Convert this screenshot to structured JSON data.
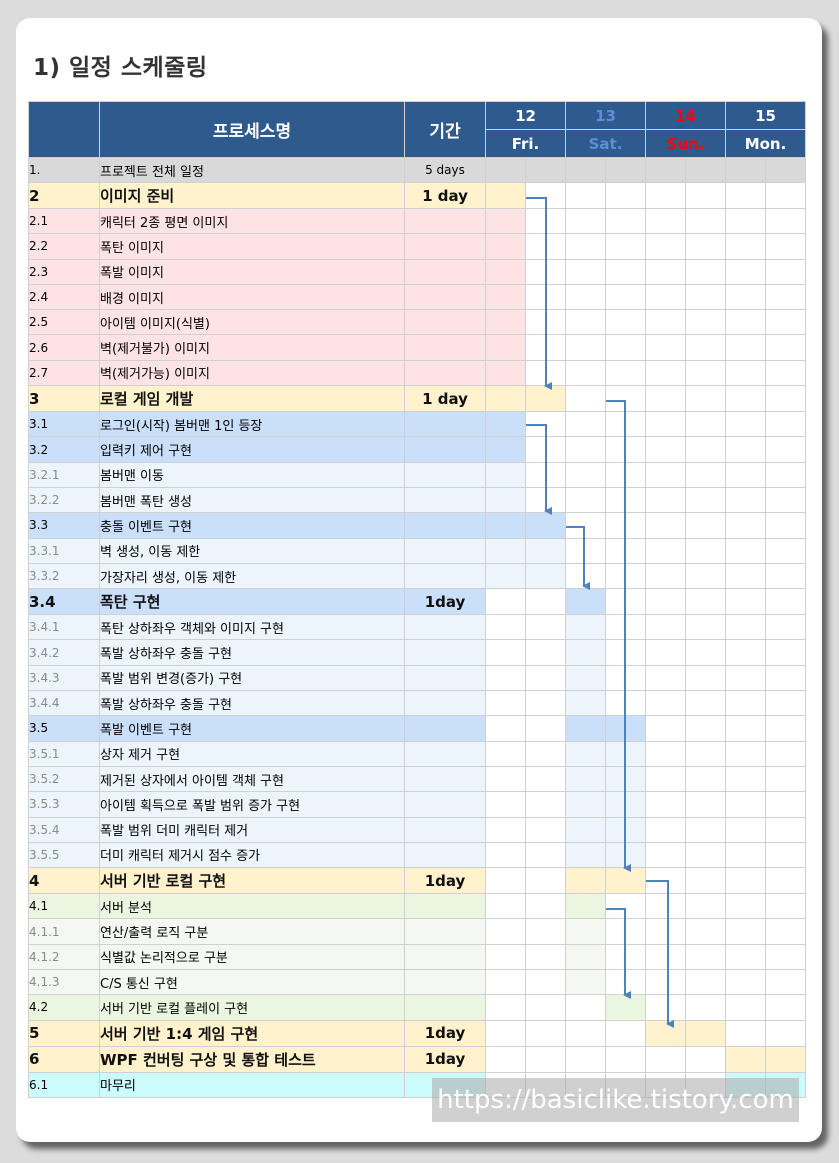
{
  "title": "1)  일정 스케줄링",
  "header": {
    "process": "프로세스명",
    "duration": "기간",
    "days": [
      {
        "day": "12",
        "dow": "Fri.",
        "color": "#ffffff"
      },
      {
        "day": "13",
        "dow": "Sat.",
        "color": "#5b8fd6"
      },
      {
        "day": "14",
        "dow": "Sun.",
        "color": "#ff0000"
      },
      {
        "day": "15",
        "dow": "Mon.",
        "color": "#ffffff"
      }
    ]
  },
  "rows": [
    {
      "num": "1.",
      "name": "프로젝트 전체 일정",
      "dur": "5 days",
      "level": "top",
      "bg": "#d9d9d9",
      "bars": [],
      "barColor": "#d9d9d9"
    },
    {
      "num": "2",
      "name": "이미지 준비",
      "dur": "1 day",
      "level": 1,
      "bg": "#fff2cc",
      "bars": [
        0
      ],
      "barColor": "#fff2cc"
    },
    {
      "num": "2.1",
      "name": "캐릭터 2종 평면 이미지",
      "dur": "",
      "level": 2,
      "bg": "#fde3e3",
      "bars": [
        0
      ],
      "barColor": "#fde3e3"
    },
    {
      "num": "2.2",
      "name": "폭탄 이미지",
      "dur": "",
      "level": 2,
      "bg": "#fde3e3",
      "bars": [
        0
      ],
      "barColor": "#fde3e3"
    },
    {
      "num": "2.3",
      "name": "폭발 이미지",
      "dur": "",
      "level": 2,
      "bg": "#fde3e3",
      "bars": [
        0
      ],
      "barColor": "#fde3e3"
    },
    {
      "num": "2.4",
      "name": "배경 이미지",
      "dur": "",
      "level": 2,
      "bg": "#fde3e3",
      "bars": [
        0
      ],
      "barColor": "#fde3e3"
    },
    {
      "num": "2.5",
      "name": "아이템 이미지(식별)",
      "dur": "",
      "level": 2,
      "bg": "#fde3e3",
      "bars": [
        0
      ],
      "barColor": "#fde3e3"
    },
    {
      "num": "2.6",
      "name": "벽(제거불가)  이미지",
      "dur": "",
      "level": 2,
      "bg": "#fde3e3",
      "bars": [
        0
      ],
      "barColor": "#fde3e3"
    },
    {
      "num": "2.7",
      "name": "벽(제거가능)  이미지",
      "dur": "",
      "level": 2,
      "bg": "#fde3e3",
      "bars": [
        0
      ],
      "barColor": "#fde3e3"
    },
    {
      "num": "3",
      "name": "로컬 게임 개발",
      "dur": "1 day",
      "level": 1,
      "bg": "#fff2cc",
      "bars": [
        0,
        1
      ],
      "barColor": "#fff2cc"
    },
    {
      "num": "3.1",
      "name": "로그인(시작) 봄버맨 1인 등장",
      "dur": "",
      "level": 2,
      "bg": "#c9dffa",
      "bars": [
        0
      ],
      "barColor": "#c9dffa"
    },
    {
      "num": "3.2",
      "name": "입력키 제어 구현",
      "dur": "",
      "level": 2,
      "bg": "#c9dffa",
      "bars": [
        0
      ],
      "barColor": "#c9dffa"
    },
    {
      "num": "3.2.1",
      "name": "봄버맨 이동",
      "dur": "",
      "level": 3,
      "bg": "#ecf4fc",
      "bars": [
        0
      ],
      "barColor": "#ecf4fc"
    },
    {
      "num": "3.2.2",
      "name": "봄버맨 폭탄 생성",
      "dur": "",
      "level": 3,
      "bg": "#ecf4fc",
      "bars": [
        0
      ],
      "barColor": "#ecf4fc"
    },
    {
      "num": "3.3",
      "name": "충돌 이벤트 구현",
      "dur": "",
      "level": 2,
      "bg": "#c9dffa",
      "bars": [
        0,
        1
      ],
      "barColor": "#c9dffa"
    },
    {
      "num": "3.3.1",
      "name": "벽 생성, 이동 제한",
      "dur": "",
      "level": 3,
      "bg": "#ecf4fc",
      "bars": [
        0,
        1
      ],
      "barColor": "#ecf4fc"
    },
    {
      "num": "3.3.2",
      "name": "가장자리 생성, 이동 제한",
      "dur": "",
      "level": 3,
      "bg": "#ecf4fc",
      "bars": [
        0,
        1
      ],
      "barColor": "#ecf4fc"
    },
    {
      "num": "3.4",
      "name": "폭탄 구현",
      "dur": "1day",
      "level": 1,
      "bg": "#c9dffa",
      "bars": [
        2
      ],
      "barColor": "#c9dffa"
    },
    {
      "num": "3.4.1",
      "name": "폭탄 상하좌우 객체와 이미지 구현",
      "dur": "",
      "level": 3,
      "bg": "#ecf4fc",
      "bars": [
        2
      ],
      "barColor": "#ecf4fc"
    },
    {
      "num": "3.4.2",
      "name": "폭발 상하좌우 충돌 구현",
      "dur": "",
      "level": 3,
      "bg": "#ecf4fc",
      "bars": [
        2
      ],
      "barColor": "#ecf4fc"
    },
    {
      "num": "3.4.3",
      "name": "폭발 범위 변경(증가) 구현",
      "dur": "",
      "level": 3,
      "bg": "#ecf4fc",
      "bars": [
        2
      ],
      "barColor": "#ecf4fc"
    },
    {
      "num": "3.4.4",
      "name": "폭발 상하좌우 충돌 구현",
      "dur": "",
      "level": 3,
      "bg": "#ecf4fc",
      "bars": [
        2
      ],
      "barColor": "#ecf4fc"
    },
    {
      "num": "3.5",
      "name": "폭발 이벤트 구현",
      "dur": "",
      "level": 2,
      "bg": "#c9dffa",
      "bars": [
        2,
        3
      ],
      "barColor": "#c9dffa"
    },
    {
      "num": "3.5.1",
      "name": "상자 제거 구현",
      "dur": "",
      "level": 3,
      "bg": "#ecf4fc",
      "bars": [
        2,
        3
      ],
      "barColor": "#ecf4fc"
    },
    {
      "num": "3.5.2",
      "name": "제거된 상자에서 아이템 객체 구현",
      "dur": "",
      "level": 3,
      "bg": "#ecf4fc",
      "bars": [
        2,
        3
      ],
      "barColor": "#ecf4fc"
    },
    {
      "num": "3.5.3",
      "name": "아이템 획득으로 폭발 범위 증가 구현",
      "dur": "",
      "level": 3,
      "bg": "#ecf4fc",
      "bars": [
        2,
        3
      ],
      "barColor": "#ecf4fc"
    },
    {
      "num": "3.5.4",
      "name": "폭발 범위 더미 캐릭터 제거",
      "dur": "",
      "level": 3,
      "bg": "#ecf4fc",
      "bars": [
        2,
        3
      ],
      "barColor": "#ecf4fc"
    },
    {
      "num": "3.5.5",
      "name": "더미 캐릭터 제거시 점수 증가",
      "dur": "",
      "level": 3,
      "bg": "#ecf4fc",
      "bars": [
        2,
        3
      ],
      "barColor": "#ecf4fc"
    },
    {
      "num": "4",
      "name": "서버 기반 로컬 구현",
      "dur": "1day",
      "level": 1,
      "bg": "#fff2cc",
      "bars": [
        2,
        3
      ],
      "barColor": "#fff2cc"
    },
    {
      "num": "4.1",
      "name": "서버 분석",
      "dur": "",
      "level": 2,
      "bg": "#eaf6e0",
      "bars": [
        2
      ],
      "barColor": "#eaf6e0"
    },
    {
      "num": "4.1.1",
      "name": "연산/출력 로직 구분",
      "dur": "",
      "level": 3,
      "bg": "#f5f8f2",
      "bars": [
        2
      ],
      "barColor": "#f5f8f2"
    },
    {
      "num": "4.1.2",
      "name": "식별값 논리적으로 구분",
      "dur": "",
      "level": 3,
      "bg": "#f5f8f2",
      "bars": [
        2
      ],
      "barColor": "#f5f8f2"
    },
    {
      "num": "4.1.3",
      "name": "C/S 통신 구현",
      "dur": "",
      "level": 3,
      "bg": "#f5f8f2",
      "bars": [
        2
      ],
      "barColor": "#f5f8f2"
    },
    {
      "num": "4.2",
      "name": "서버 기반 로컬 플레이 구현",
      "dur": "",
      "level": 2,
      "bg": "#eaf6e0",
      "bars": [
        3
      ],
      "barColor": "#eaf6e0"
    },
    {
      "num": "5",
      "name": "서버 기반 1:4 게임 구현",
      "dur": "1day",
      "level": 1,
      "bg": "#fff2cc",
      "bars": [
        4,
        5
      ],
      "barColor": "#fff2cc"
    },
    {
      "num": "6",
      "name": "WPF 컨버팅 구상 및 통합 테스트",
      "dur": "1day",
      "level": 1,
      "bg": "#fff2cc",
      "bars": [
        6,
        7
      ],
      "barColor": "#fff2cc"
    },
    {
      "num": "6.1",
      "name": "마무리",
      "dur": "",
      "level": 2,
      "bg": "#ccfbfb",
      "bars": [
        6,
        7
      ],
      "barColor": "#ccfbfb"
    }
  ],
  "watermark": "https://basiclike.tistory.com",
  "colors": {
    "header": "#2f5a8e",
    "arrow": "#4f81bd",
    "cardBg": "#ffffff",
    "pageBg": "#dcdcdc"
  }
}
